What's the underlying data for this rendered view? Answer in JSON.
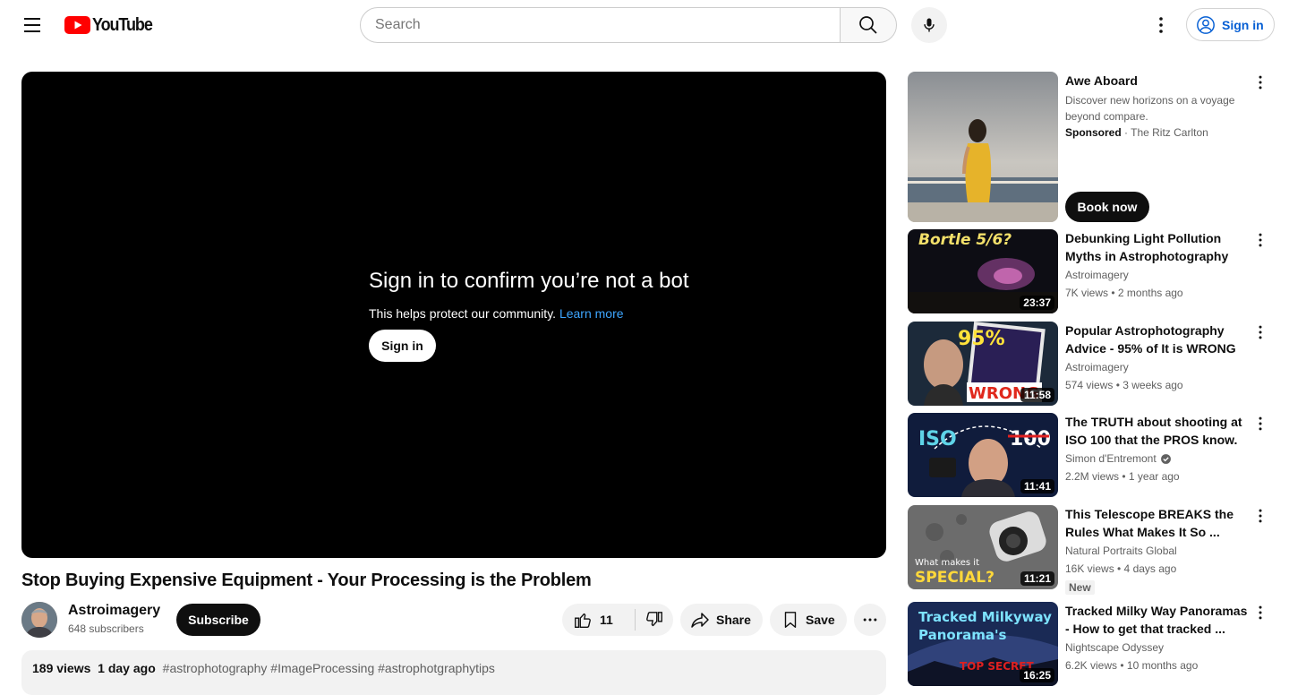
{
  "header": {
    "logo_text": "YouTube",
    "search_placeholder": "Search",
    "signin_label": "Sign in"
  },
  "player": {
    "bot_title": "Sign in to confirm you’re not a bot",
    "bot_sub": "This helps protect our community.",
    "learn_more": "Learn more",
    "signin_label": "Sign in"
  },
  "video": {
    "title": "Stop Buying Expensive Equipment - Your Processing is the Problem",
    "channel": "Astroimagery",
    "subscribers": "648 subscribers",
    "subscribe_label": "Subscribe",
    "likes": "11",
    "share_label": "Share",
    "save_label": "Save",
    "views": "189 views",
    "age": "1 day ago",
    "tags": "#astrophotography #ImageProcessing #astrophotgraphytips"
  },
  "sidebar": {
    "ad": {
      "title": "Awe Aboard",
      "description": "Discover new horizons on a voyage beyond compare.",
      "sponsored": "Sponsored",
      "advertiser": "The Ritz Carlton",
      "cta": "Book now"
    },
    "videos": [
      {
        "title": "Debunking Light Pollution Myths in Astrophotography",
        "channel": "Astroimagery",
        "meta": "7K views • 2 months ago",
        "duration": "23:37",
        "thumb_text": "Bortle 5/6?"
      },
      {
        "title": "Popular Astrophotography Advice - 95% of It is WRONG f...",
        "channel": "Astroimagery",
        "meta": "574 views • 3 weeks ago",
        "duration": "11:58",
        "thumb_text": "95%",
        "thumb_text2": "WRONG"
      },
      {
        "title": "The TRUTH about shooting at ISO 100 that the PROS know.",
        "channel": "Simon d'Entremont",
        "meta": "2.2M views • 1 year ago",
        "duration": "11:41",
        "thumb_text": "ISO",
        "thumb_text2": "100"
      },
      {
        "title": "This Telescope BREAKS the Rules  What Makes It So ...",
        "channel": "Natural Portraits Global",
        "meta": "16K views • 4 days ago",
        "duration": "11:21",
        "thumb_text": "What makes it",
        "thumb_text2": "SPECIAL?",
        "badge": "New"
      },
      {
        "title": "Tracked Milky Way Panoramas - How to get that tracked ...",
        "channel": "Nightscape Odyssey",
        "meta": "6.2K views • 10 months ago",
        "duration": "16:25",
        "thumb_text": "Tracked Milkyway",
        "thumb_text2": "Panorama's",
        "thumb_text3": "TOP SECRET"
      }
    ]
  },
  "colors": {
    "brand_red": "#ff0000",
    "link_blue": "#065fd4",
    "learn_more_blue": "#3ea6ff"
  }
}
